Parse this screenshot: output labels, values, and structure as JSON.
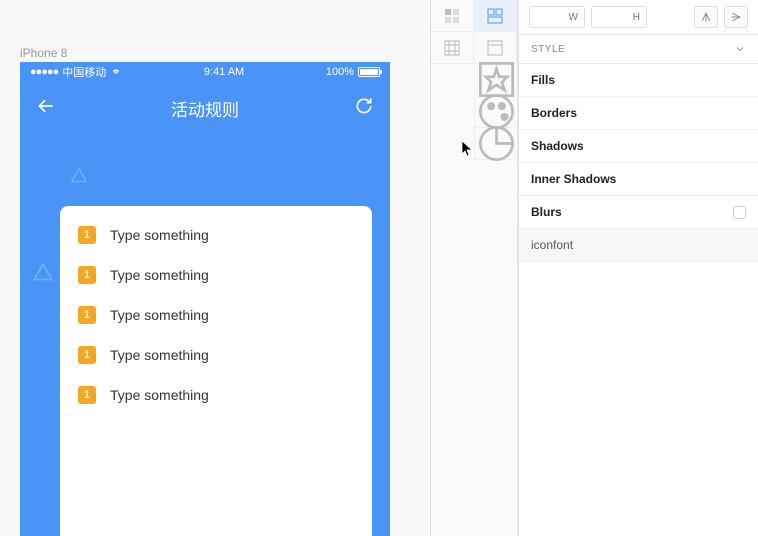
{
  "canvas": {
    "device_label": "iPhone 8"
  },
  "status_bar": {
    "signal_dots": "●●●●●",
    "carrier": "中国移动",
    "time": "9:41 AM",
    "battery_pct": "100%"
  },
  "nav": {
    "title": "活动规则"
  },
  "rules": [
    {
      "num": "1",
      "text": "Type something"
    },
    {
      "num": "1",
      "text": "Type something"
    },
    {
      "num": "1",
      "text": "Type something"
    },
    {
      "num": "1",
      "text": "Type something"
    },
    {
      "num": "1",
      "text": "Type something"
    }
  ],
  "inspector": {
    "w_label": "W",
    "h_label": "H",
    "style_header": "STYLE",
    "rows": {
      "fills": "Fills",
      "borders": "Borders",
      "shadows": "Shadows",
      "inner_shadows": "Inner Shadows",
      "blurs": "Blurs",
      "iconfont": "iconfont"
    }
  }
}
